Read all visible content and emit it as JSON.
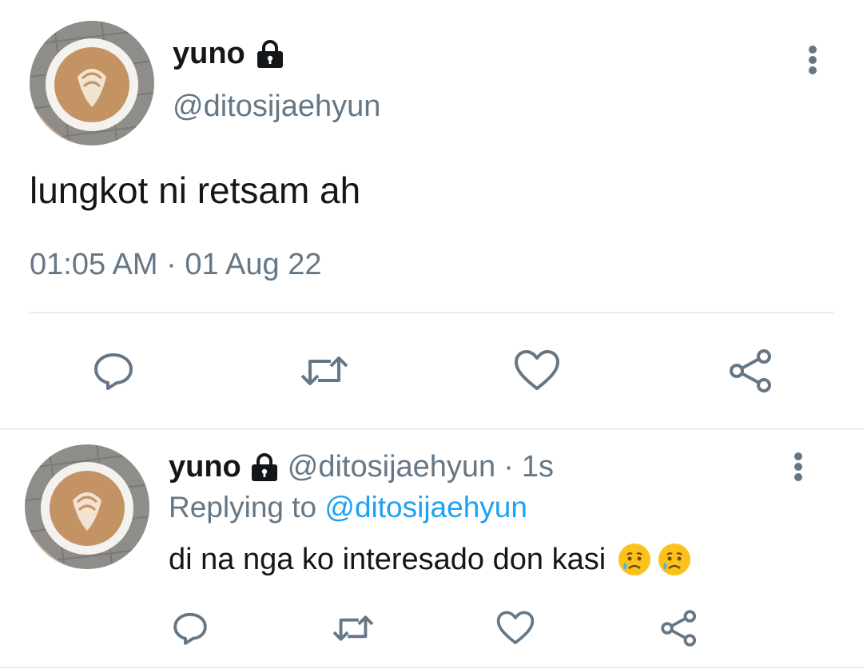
{
  "main_tweet": {
    "display_name": "yuno",
    "handle": "@ditosijaehyun",
    "text": "lungkot ni retsam ah",
    "timestamp": "01:05 AM · 01 Aug 22",
    "locked": true,
    "more_icon": "more-vertical-icon"
  },
  "actions": {
    "reply_icon": "reply-icon",
    "retweet_icon": "retweet-icon",
    "like_icon": "like-icon",
    "share_icon": "share-icon"
  },
  "reply_tweet": {
    "display_name": "yuno",
    "handle": "@ditosijaehyun",
    "separator": "·",
    "time": "1s",
    "replying_prefix": "Replying to",
    "replying_handle": "@ditosijaehyun",
    "text": "di na nga ko interesado don kasi",
    "emojis": [
      "crying-face",
      "crying-face"
    ],
    "locked": true
  },
  "colors": {
    "text_primary": "#14171a",
    "text_secondary": "#657786",
    "link": "#1da1f2",
    "icon": "#657786",
    "divider": "#e6ecf0"
  }
}
